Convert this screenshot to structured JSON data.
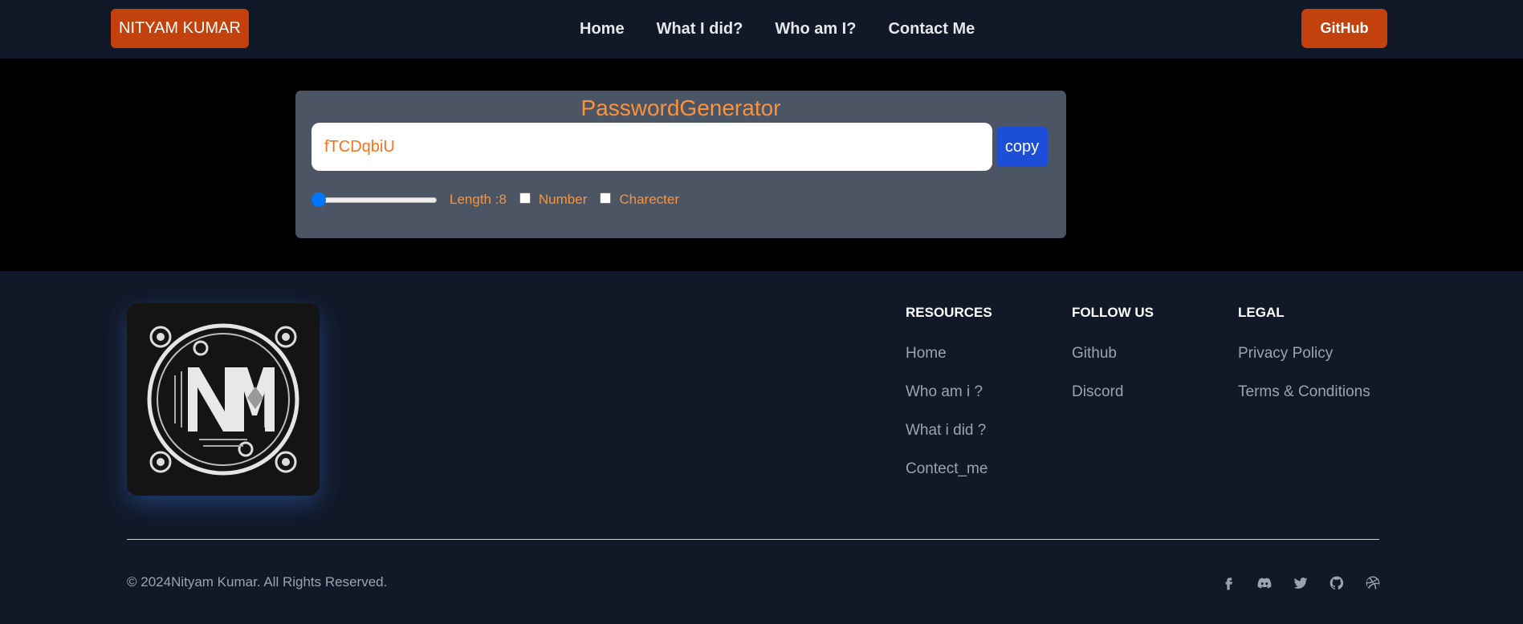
{
  "nav": {
    "brand": "NITYAM KUMAR",
    "links": [
      "Home",
      "What I did?",
      "Who am I?",
      "Contact Me"
    ],
    "github": "GitHub"
  },
  "generator": {
    "title": "PasswordGenerator",
    "password": "fTCDqbiU",
    "copy_label": "copy",
    "length_label": "Length :8",
    "number_label": "Number",
    "character_label": "Charecter",
    "length_value": 8,
    "number_checked": false,
    "character_checked": false
  },
  "footer": {
    "resources": {
      "heading": "RESOURCES",
      "links": [
        "Home",
        "Who am i ?",
        "What i did ?",
        "Contect_me"
      ]
    },
    "follow": {
      "heading": "FOLLOW US",
      "links": [
        "Github",
        "Discord"
      ]
    },
    "legal": {
      "heading": "LEGAL",
      "links": [
        "Privacy Policy",
        "Terms & Conditions"
      ]
    },
    "copyright": "© 2024Nityam Kumar. All Rights Reserved.",
    "social_icons": [
      "facebook-icon",
      "discord-icon",
      "twitter-icon",
      "github-icon",
      "dribbble-icon"
    ]
  },
  "colors": {
    "accent": "#c2410c",
    "text_orange": "#fb923c",
    "copy_button": "#1d4ed8",
    "card_bg": "#4b5563",
    "nav_bg": "#111827"
  }
}
